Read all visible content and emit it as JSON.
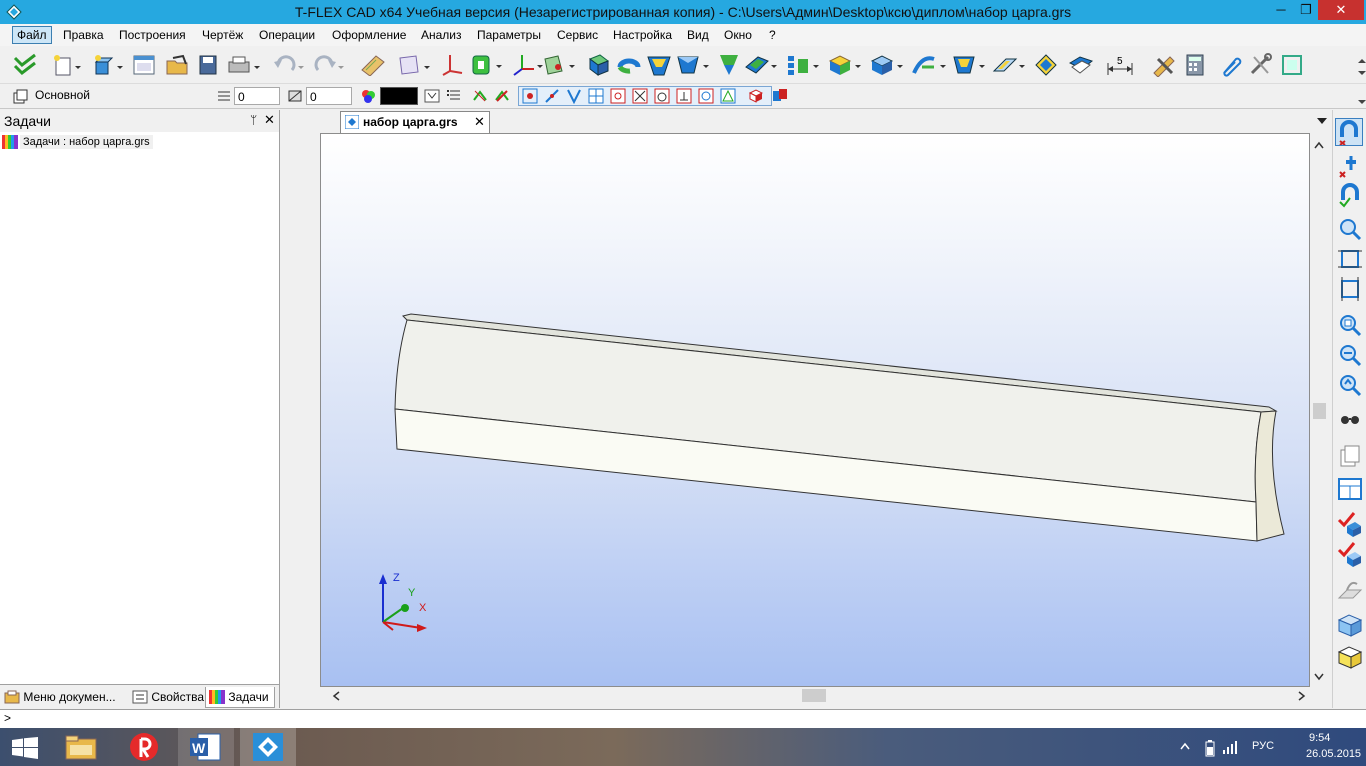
{
  "window": {
    "title": "T-FLEX CAD x64 Учебная версия (Незарегистрированная копия) - C:\\Users\\Админ\\Desktop\\ксю\\диплом\\набор царга.grs",
    "min_glyph": "─",
    "max_glyph": "❐",
    "close_glyph": "✕"
  },
  "menu": [
    "Файл",
    "Правка",
    "Построения",
    "Чертёж",
    "Операции",
    "Оформление",
    "Анализ",
    "Параметры",
    "Сервис",
    "Настройка",
    "Вид",
    "Окно",
    "?"
  ],
  "toolbar2": {
    "layer_label": "Основной",
    "level_value": "0",
    "priority_value": "0",
    "color_value": "#000000"
  },
  "left_panel": {
    "title": "Задачи",
    "pin_glyph": "📌",
    "close_glyph": "✕",
    "item": "Задачи : набор царга.grs",
    "tabs": [
      "Меню докумен...",
      "Свойства",
      "Задачи"
    ]
  },
  "document_tab": {
    "label": "набор царга.grs",
    "close_glyph": "✕"
  },
  "axes": {
    "z": "Z",
    "y": "Y",
    "x": "X"
  },
  "command_line": {
    "prompt": ">"
  },
  "tray": {
    "lang": "РУС",
    "time": "9:54",
    "date": "26.05.2015"
  },
  "colors": {
    "titlebar": "#26a8e0",
    "accent_blue": "#1e78d0",
    "close_red": "#c7312f"
  }
}
